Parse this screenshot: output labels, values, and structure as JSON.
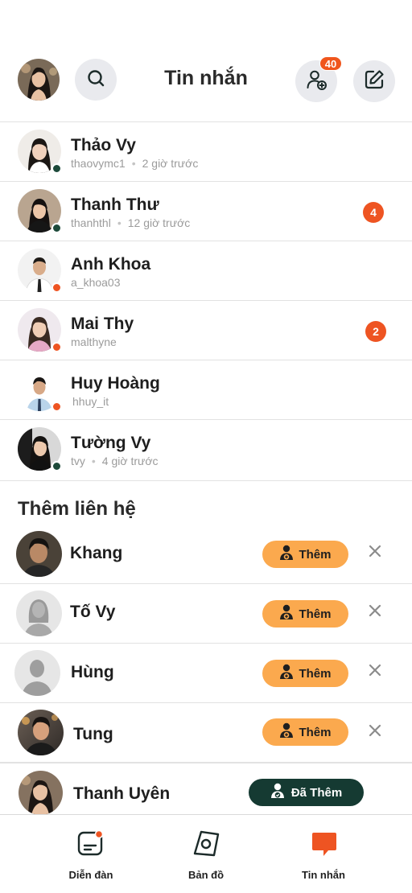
{
  "header": {
    "title": "Tin nhắn",
    "friend_request_count": "40",
    "icons": {
      "search": "search-icon",
      "add_friend": "add-user-icon",
      "compose": "compose-icon"
    }
  },
  "conversations": [
    {
      "name": "Thảo Vy",
      "username": "thaovymc1",
      "time": "2 giờ trước",
      "status": "online",
      "unread": ""
    },
    {
      "name": "Thanh Thư",
      "username": "thanhthl",
      "time": "12 giờ trước",
      "status": "online",
      "unread": "4"
    },
    {
      "name": "Anh Khoa",
      "username": "a_khoa03",
      "time": "",
      "status": "away",
      "unread": ""
    },
    {
      "name": "Mai Thy",
      "username": "malthyne",
      "time": "",
      "status": "away",
      "unread": "2"
    },
    {
      "name": "Huy Hoàng",
      "username": "hhuy_it",
      "time": "",
      "status": "away",
      "unread": ""
    },
    {
      "name": "Tường Vy",
      "username": "tvy",
      "time": "4 giờ trước",
      "status": "online",
      "unread": ""
    }
  ],
  "suggestions": {
    "title": "Thêm liên hệ",
    "add_label": "Thêm",
    "added_label": "Đã Thêm",
    "items": [
      {
        "name": "Khang",
        "added": false
      },
      {
        "name": "Tố Vy",
        "added": false
      },
      {
        "name": "Hùng",
        "added": false
      },
      {
        "name": "Tung",
        "added": false
      },
      {
        "name": "Thanh Uyên",
        "added": true
      }
    ]
  },
  "nav": {
    "items": [
      {
        "label": "Diễn đàn",
        "icon": "forum-icon",
        "active": false
      },
      {
        "label": "Bản đồ",
        "icon": "map-icon",
        "active": false
      },
      {
        "label": "Tin nhắn",
        "icon": "chat-icon",
        "active": true
      }
    ]
  },
  "colors": {
    "accent": "#ee5422",
    "online": "#1d4a3a",
    "add_button": "#fba94e",
    "added_button": "#153a32"
  }
}
